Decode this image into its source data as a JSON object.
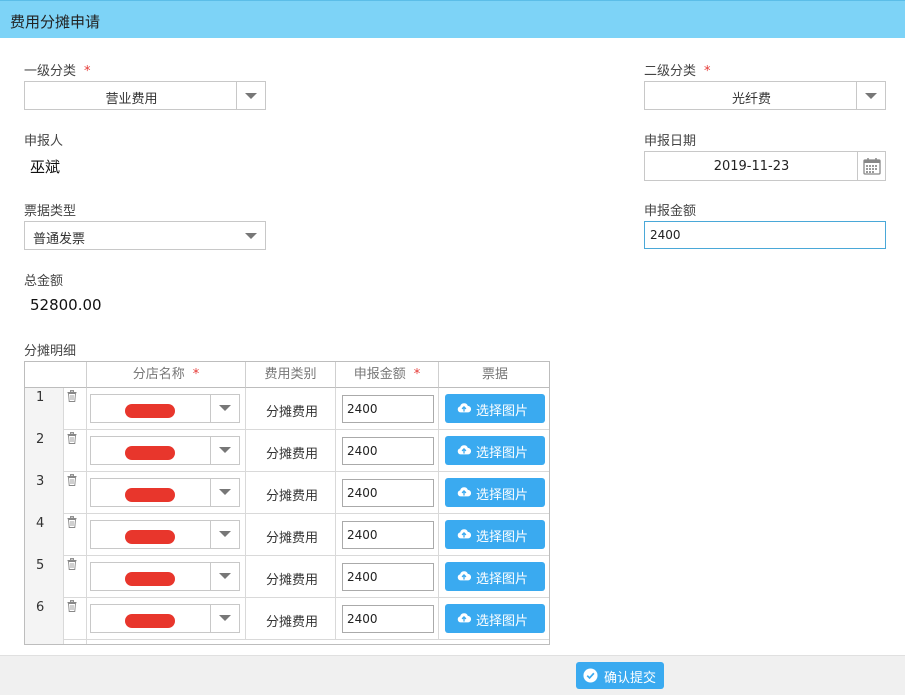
{
  "dialog": {
    "title": "费用分摊申请"
  },
  "form": {
    "level1": {
      "label": "一级分类",
      "required": "*",
      "value": "营业费用"
    },
    "level2": {
      "label": "二级分类",
      "required": "*",
      "value": "光纤费"
    },
    "applicant": {
      "label": "申报人",
      "value": "巫斌"
    },
    "date": {
      "label": "申报日期",
      "value": "2019-11-23"
    },
    "invoice_type": {
      "label": "票据类型",
      "value": "普通发票"
    },
    "amount": {
      "label": "申报金额",
      "value": "2400"
    },
    "total": {
      "label": "总金额",
      "value": "52800.00"
    },
    "detail_label": "分摊明细"
  },
  "table": {
    "columns": [
      "分店名称",
      "费用类别",
      "申报金额",
      "票据"
    ],
    "required_mark": "*",
    "rows": [
      {
        "no": "1",
        "type": "分摊费用",
        "amount": "2400",
        "upload": "选择图片"
      },
      {
        "no": "2",
        "type": "分摊费用",
        "amount": "2400",
        "upload": "选择图片"
      },
      {
        "no": "3",
        "type": "分摊费用",
        "amount": "2400",
        "upload": "选择图片"
      },
      {
        "no": "4",
        "type": "分摊费用",
        "amount": "2400",
        "upload": "选择图片"
      },
      {
        "no": "5",
        "type": "分摊费用",
        "amount": "2400",
        "upload": "选择图片"
      },
      {
        "no": "6",
        "type": "分摊费用",
        "amount": "2400",
        "upload": "选择图片"
      }
    ]
  },
  "footer": {
    "confirm_label": "确认提交"
  },
  "colors": {
    "titlebar": "#7dd3f7",
    "primary_button": "#3aaaf0",
    "required": "#e53935",
    "redaction": "#e8362c"
  },
  "icons": [
    "trash-icon",
    "chevron-down-icon",
    "calendar-icon",
    "cloud-upload-icon",
    "check-circle-icon"
  ]
}
